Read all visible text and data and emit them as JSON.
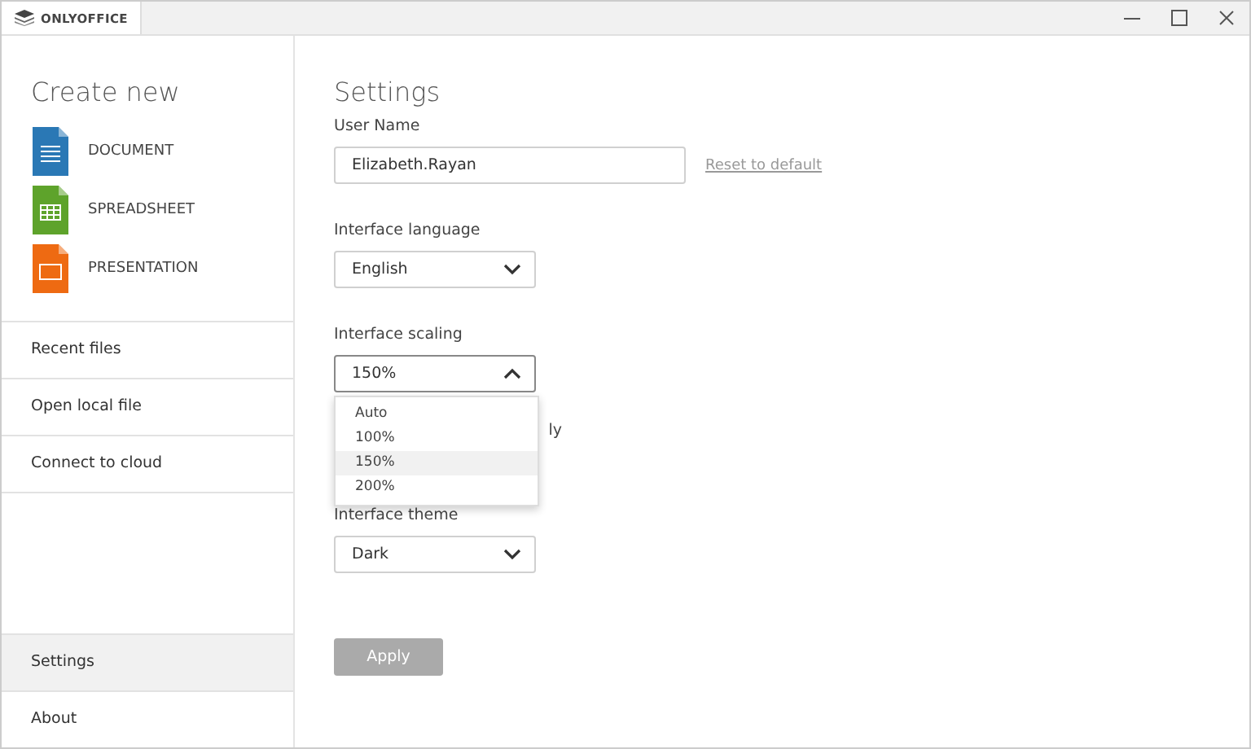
{
  "window": {
    "tab": "ONLYOFFICE"
  },
  "sidebar": {
    "create_title": "Create new",
    "create_items": [
      {
        "label": "DOCUMENT",
        "kind": "document"
      },
      {
        "label": "SPREADSHEET",
        "kind": "spreadsheet"
      },
      {
        "label": "PRESENTATION",
        "kind": "presentation"
      }
    ],
    "nav_top": [
      {
        "label": "Recent files",
        "selected": false
      },
      {
        "label": "Open local file",
        "selected": false
      },
      {
        "label": "Connect to cloud",
        "selected": false
      }
    ],
    "nav_bottom": [
      {
        "label": "Settings",
        "selected": true
      },
      {
        "label": "About",
        "selected": false
      }
    ]
  },
  "settings": {
    "title": "Settings",
    "user_name": {
      "label": "User Name",
      "value": "Elizabeth.Rayan",
      "reset_link": "Reset to default"
    },
    "language": {
      "label": "Interface language",
      "value": "English",
      "expanded": false
    },
    "scaling": {
      "label": "Interface scaling",
      "value": "150%",
      "expanded": true,
      "options": [
        {
          "label": "Auto",
          "selected": false
        },
        {
          "label": "100%",
          "selected": false
        },
        {
          "label": "150%",
          "selected": true
        },
        {
          "label": "200%",
          "selected": false
        }
      ]
    },
    "covered_label_tail": "ly",
    "theme": {
      "label": "Interface theme",
      "value": "Dark",
      "expanded": false
    },
    "apply_button": {
      "label": "Apply",
      "disabled": true
    }
  }
}
